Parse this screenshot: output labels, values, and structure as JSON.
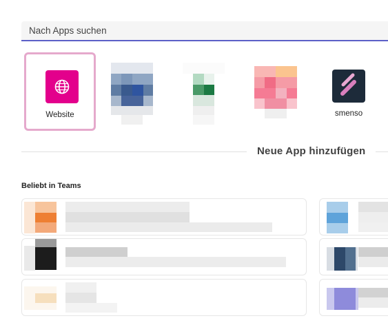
{
  "search": {
    "placeholder": "Nach Apps suchen"
  },
  "recent_apps": [
    {
      "name": "Website",
      "icon": "globe-icon",
      "color": "#e3008c",
      "selected": true
    },
    {
      "name": "",
      "icon": "blurred-app-icon"
    },
    {
      "name": "",
      "icon": "blurred-app-icon"
    },
    {
      "name": "",
      "icon": "blurred-app-icon"
    },
    {
      "name": "smenso",
      "icon": "smenso-logo-icon",
      "color": "#1d2b3a"
    }
  ],
  "add_app_label": "Neue App hinzufügen",
  "popular_section": {
    "title": "Beliebt in Teams"
  },
  "colors": {
    "accent": "#5b5fc7",
    "selection_border": "#e5a9cc"
  }
}
